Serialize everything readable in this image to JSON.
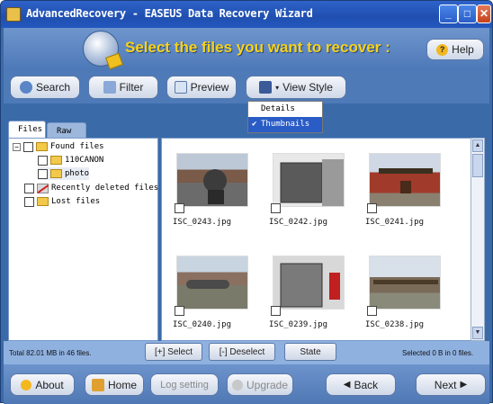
{
  "window": {
    "title": "AdvancedRecovery - EASEUS Data Recovery Wizard"
  },
  "header": {
    "title": "Select the files you want to recover :",
    "help_label": "Help"
  },
  "toolbar": {
    "search_label": "Search",
    "filter_label": "Filter",
    "preview_label": "Preview",
    "viewstyle_label": "View Style"
  },
  "view_menu": {
    "items": [
      {
        "label": "Details"
      },
      {
        "label": "Thumbnails",
        "checked": true
      }
    ]
  },
  "tabs": [
    {
      "label": "Files"
    },
    {
      "label": "Raw"
    }
  ],
  "tree": {
    "found": "Found files",
    "folder1": "110CANON",
    "folder2": "photo",
    "deleted": "Recently deleted files",
    "lost": "Lost files"
  },
  "files": [
    {
      "name": "ISC_0243.jpg"
    },
    {
      "name": "ISC_0242.jpg"
    },
    {
      "name": "ISC_0241.jpg"
    },
    {
      "name": "ISC_0240.jpg"
    },
    {
      "name": "ISC_0239.jpg"
    },
    {
      "name": "ISC_0238.jpg"
    }
  ],
  "status": {
    "total": "Total 82.01 MB in 46 files.",
    "select_label": "[+] Select",
    "deselect_label": "[-] Deselect",
    "state_label": "State",
    "selected": "Selected 0 B in 0 files."
  },
  "footer": {
    "about": "About",
    "home": "Home",
    "log": "Log setting",
    "upgrade": "Upgrade",
    "back": "Back",
    "next": "Next"
  },
  "colors": {
    "accent": "#f6d21a",
    "titlebar": "#2458be",
    "panel": "#4f7ab8"
  }
}
